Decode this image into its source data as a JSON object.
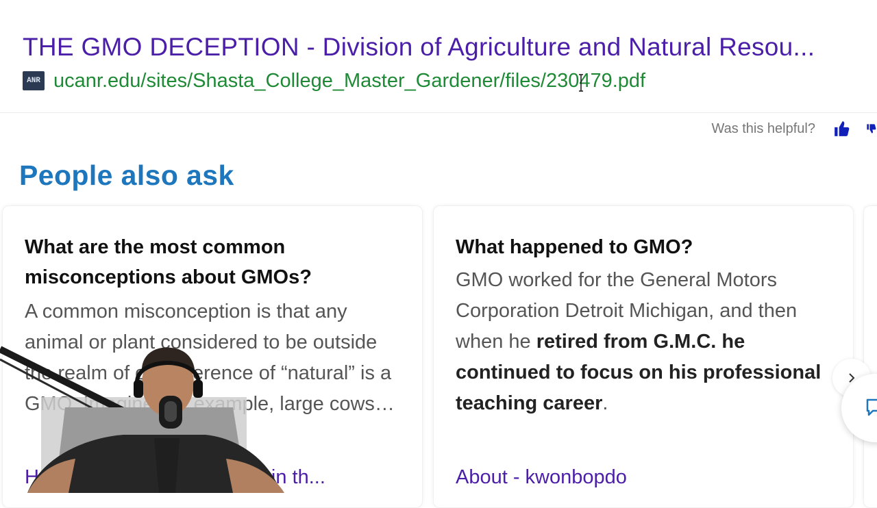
{
  "result": {
    "title": "THE GMO DECEPTION - Division of Agriculture and Natural Resou...",
    "favicon_text": "ANR",
    "url": "ucanr.edu/sites/Shasta_College_Master_Gardener/files/230479.pdf"
  },
  "feedback": {
    "prompt": "Was this helpful?",
    "up_icon": "thumbs-up-icon",
    "down_icon": "thumbs-down-icon"
  },
  "people_also_ask": {
    "heading": "People also ask",
    "cards": [
      {
        "question": "What are the most common misconceptions about GMOs?",
        "answer": "A common misconception is that any animal or plant considered to be outside the realm of our reference of “natural” is a GMO. Imagine, for example, large cows…",
        "link": "How GMOs Work | Science in th..."
      },
      {
        "question": "What happened to GMO?",
        "answer_plain": "GMO worked for the General Motors Corporation Detroit Michigan, and then when he ",
        "answer_bold": "retired from G.M.C. he continued to focus on his professional teaching career",
        "answer_end": ".",
        "link": "About - kwonbopdo"
      }
    ]
  },
  "colors": {
    "title": "#4b1ea8",
    "url": "#1f8a36",
    "heading": "#1e77bd",
    "thumb": "#1020b8"
  },
  "icons": {
    "next": "chevron-right-icon",
    "chat": "chat-icon"
  }
}
